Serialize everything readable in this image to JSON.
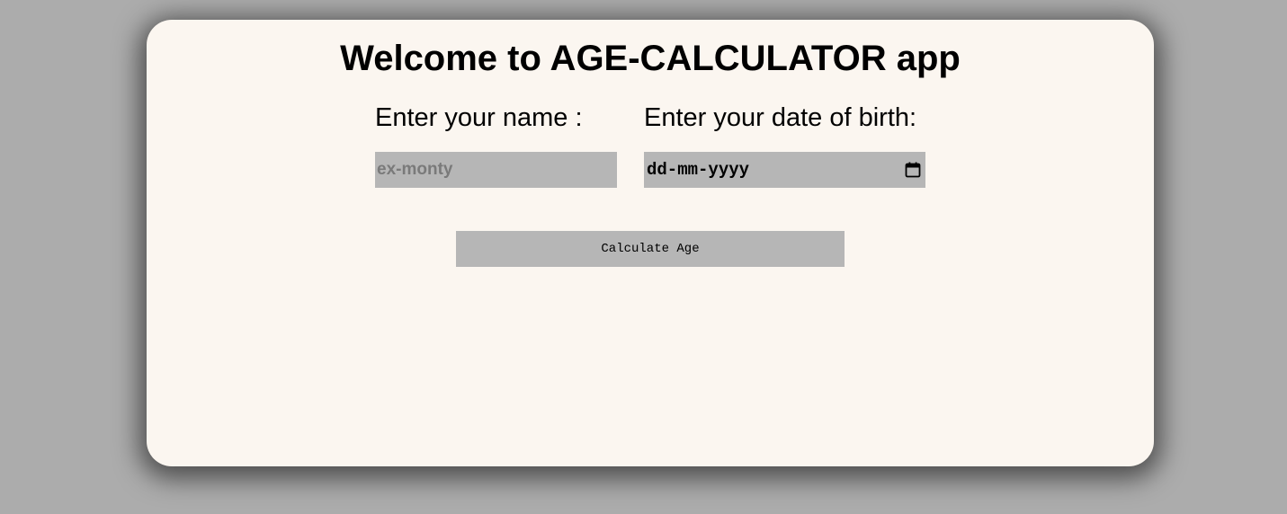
{
  "app": {
    "title": "Welcome to AGE-CALCULATOR app"
  },
  "form": {
    "name_label": "Enter your name :",
    "name_placeholder": "ex-monty",
    "name_value": "",
    "dob_label": "Enter your date of birth:",
    "dob_display": "dd-mm-yyyy",
    "dob_icon": "calendar-icon"
  },
  "actions": {
    "calculate_label": "Calculate Age"
  },
  "colors": {
    "page_background": "#acacac",
    "card_background": "#fbf6f0",
    "control_background": "#b6b6b6"
  }
}
